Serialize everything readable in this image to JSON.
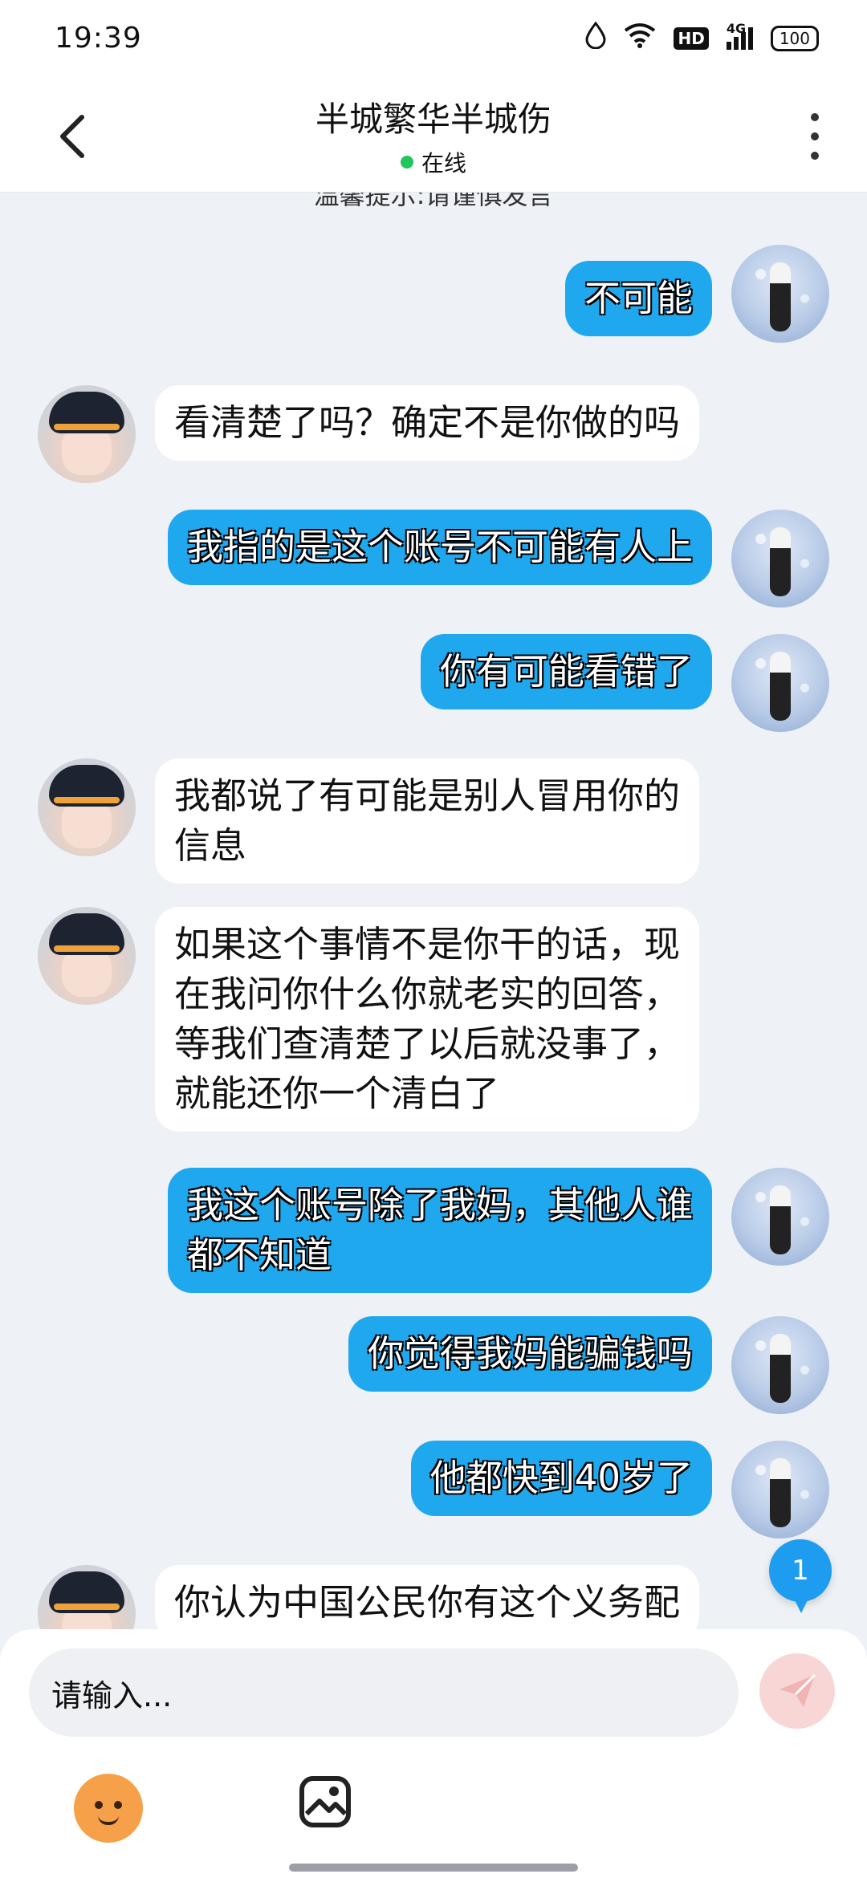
{
  "status_bar": {
    "time": "19:39",
    "network": "4G",
    "hd": "HD",
    "battery": "100"
  },
  "header": {
    "title": "半城繁华半城伤",
    "status": "在线"
  },
  "tip": "温馨提示:请谨慎发言",
  "messages": [
    {
      "side": "right",
      "text": "不可能"
    },
    {
      "side": "left",
      "text": "看清楚了吗？确定不是你做的吗"
    },
    {
      "side": "right",
      "text": "我指的是这个账号不可能有人上"
    },
    {
      "side": "right",
      "text": "你有可能看错了"
    },
    {
      "side": "left",
      "text": "我都说了有可能是别人冒用你的\n信息"
    },
    {
      "side": "left",
      "text": "如果这个事情不是你干的话，现\n在我问你什么你就老实的回答，\n等我们查清楚了以后就没事了，\n就能还你一个清白了"
    },
    {
      "side": "right",
      "text": "我这个账号除了我妈，其他人谁\n都不知道"
    },
    {
      "side": "right",
      "text": "你觉得我妈能骗钱吗"
    },
    {
      "side": "right",
      "text": "他都快到40岁了"
    },
    {
      "side": "left",
      "text": "你认为中国公民你有这个义务配"
    }
  ],
  "unread_count": "1",
  "input": {
    "placeholder": "请输入..."
  },
  "icons": {
    "back": "back-arrow-icon",
    "more": "more-vertical-icon",
    "send": "send-icon",
    "emoji": "emoji-mascot-icon",
    "image": "image-icon"
  },
  "colors": {
    "bubble_right": "#20a8ee",
    "bubble_left": "#ffffff",
    "online": "#22c55e",
    "unread": "#1e9cf0"
  }
}
